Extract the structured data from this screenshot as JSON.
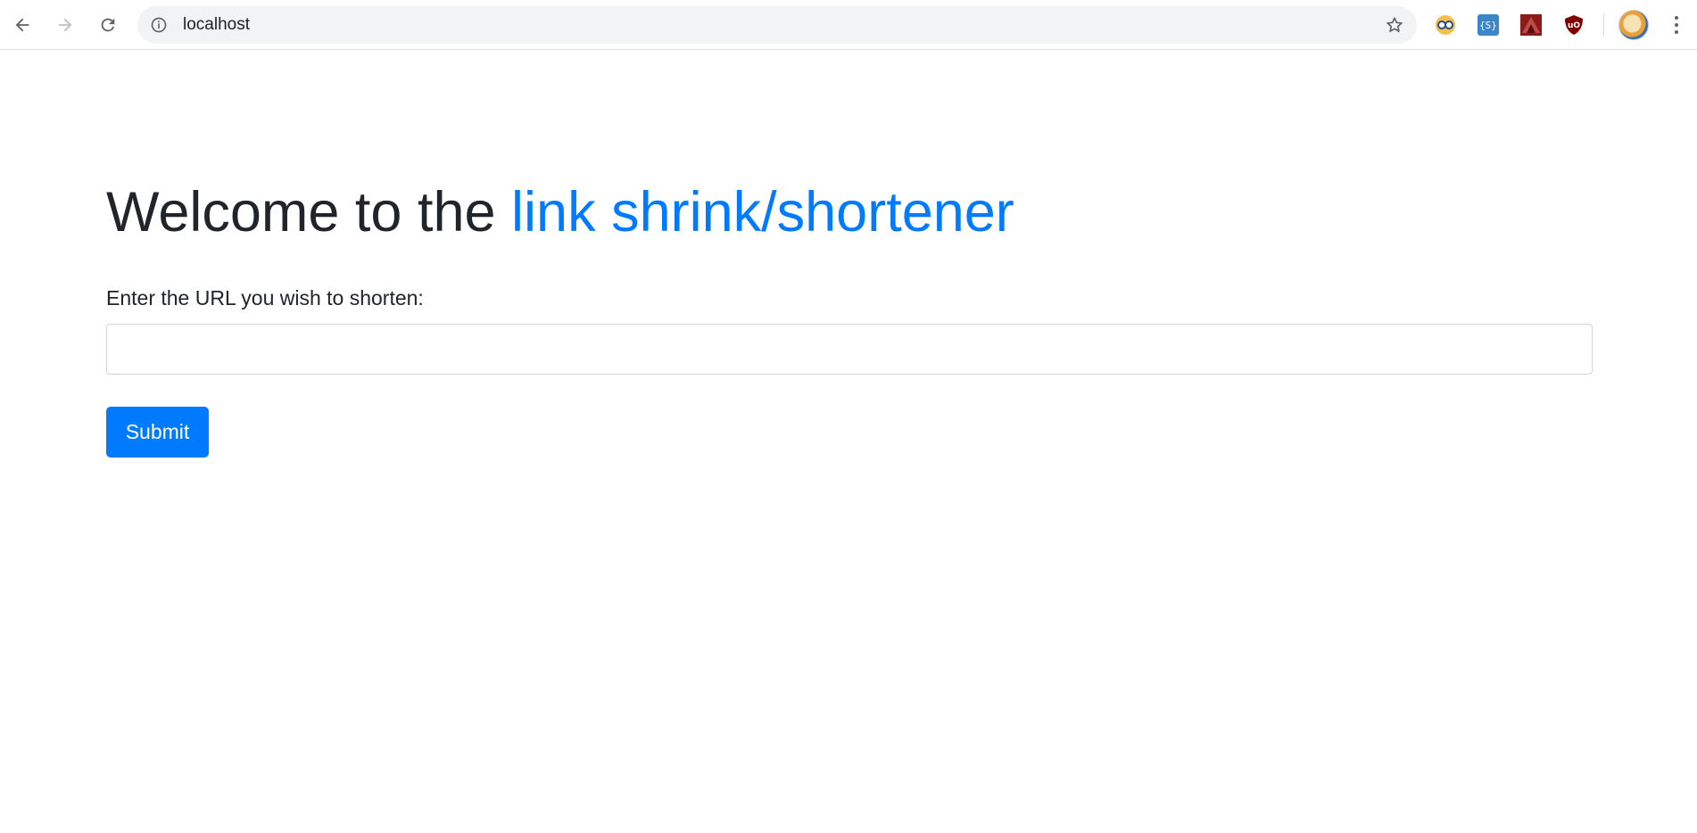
{
  "browser": {
    "address_bar": {
      "url": "localhost"
    },
    "icons": {
      "back": "back-arrow-icon",
      "forward": "forward-arrow-icon",
      "reload": "reload-icon",
      "site_info": "info-icon",
      "bookmark": "star-icon",
      "menu": "more-vertical-icon"
    },
    "extensions": [
      {
        "name": "extension-1-icon",
        "color": "#e8a53b"
      },
      {
        "name": "extension-2-icon",
        "color": "#3a86c8"
      },
      {
        "name": "extension-3-icon",
        "color": "#8b1a1a"
      },
      {
        "name": "ublock-icon",
        "color": "#800000"
      }
    ]
  },
  "page": {
    "heading": {
      "prefix": "Welcome to the ",
      "highlight": "link shrink/shortener"
    },
    "form": {
      "label": "Enter the URL you wish to shorten:",
      "input_value": "",
      "input_placeholder": "",
      "submit_label": "Submit"
    }
  },
  "colors": {
    "accent": "#007bff",
    "text": "#212529",
    "input_border": "#ced4da",
    "toolbar_bg": "#ffffff",
    "omnibox_bg": "#f1f3f4"
  }
}
